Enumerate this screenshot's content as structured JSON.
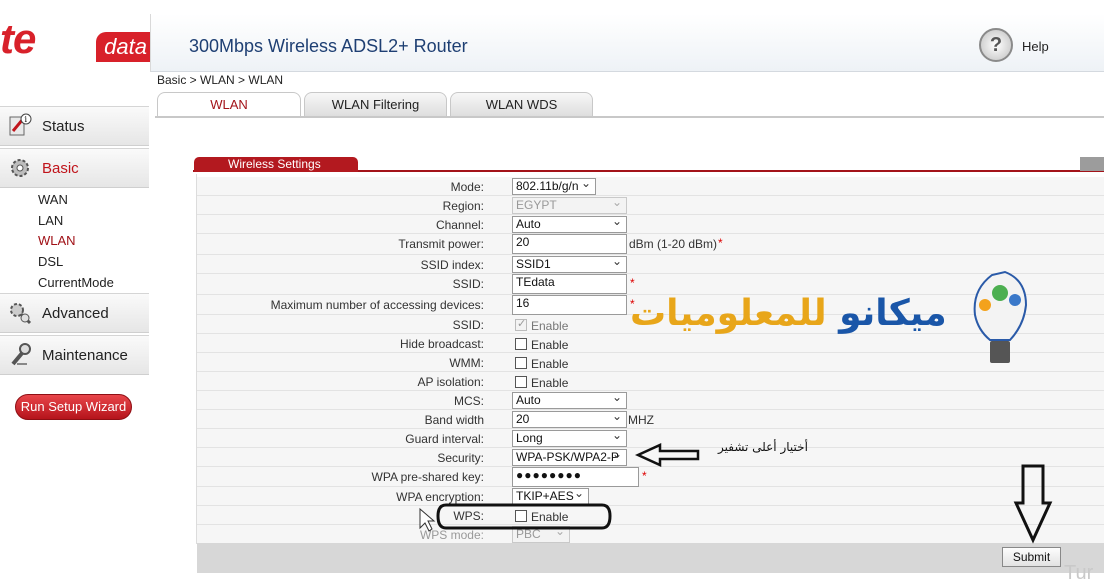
{
  "brand": {
    "logo_te": "te",
    "logo_data": "data"
  },
  "header": {
    "title": "300Mbps Wireless ADSL2+ Router",
    "help_label": "Help"
  },
  "breadcrumb": "Basic > WLAN > WLAN",
  "tabs": [
    {
      "label": "WLAN"
    },
    {
      "label": "WLAN Filtering"
    },
    {
      "label": "WLAN WDS"
    }
  ],
  "sidebar": {
    "status": "Status",
    "basic": "Basic",
    "basic_items": [
      "WAN",
      "LAN",
      "WLAN",
      "DSL",
      "CurrentMode"
    ],
    "advanced": "Advanced",
    "maintenance": "Maintenance",
    "wizard": "Run Setup Wizard"
  },
  "section_title": "Wireless Settings",
  "form": {
    "mode": {
      "label": "Mode:",
      "value": "802.11b/g/n"
    },
    "region": {
      "label": "Region:",
      "value": "EGYPT"
    },
    "channel": {
      "label": "Channel:",
      "value": "Auto"
    },
    "tx_power": {
      "label": "Transmit power:",
      "value": "20",
      "unit": "dBm (1-20 dBm)"
    },
    "ssid_index": {
      "label": "SSID index:",
      "value": "SSID1"
    },
    "ssid": {
      "label": "SSID:",
      "value": "TEdata"
    },
    "max_devices": {
      "label": "Maximum number of accessing devices:",
      "value": "16"
    },
    "ssid_enable": {
      "label": "SSID:",
      "enable": "Enable",
      "checked": true
    },
    "hide_broadcast": {
      "label": "Hide broadcast:",
      "enable": "Enable",
      "checked": false
    },
    "wmm": {
      "label": "WMM:",
      "enable": "Enable",
      "checked": false
    },
    "ap_isolation": {
      "label": "AP isolation:",
      "enable": "Enable",
      "checked": false
    },
    "mcs": {
      "label": "MCS:",
      "value": "Auto"
    },
    "bandwidth": {
      "label": "Band width",
      "value": "20",
      "unit": "MHZ"
    },
    "guard": {
      "label": "Guard interval:",
      "value": "Long"
    },
    "security": {
      "label": "Security:",
      "value": "WPA-PSK/WPA2-P"
    },
    "psk": {
      "label": "WPA pre-shared key:",
      "value": "●●●●●●●●"
    },
    "encryption": {
      "label": "WPA encryption:",
      "value": "TKIP+AES"
    },
    "wps": {
      "label": "WPS:",
      "enable": "Enable",
      "checked": false
    },
    "wps_mode": {
      "label": "WPS mode:",
      "value": "PBC"
    },
    "required_mark": "*"
  },
  "submit_label": "Submit",
  "annotation_text": "أختيار أعلى تشفير",
  "watermark": {
    "part1": "ميكانو",
    "part2": "للمعلوميات"
  },
  "corner_text": "Tur",
  "colors": {
    "brand_red": "#d8212a",
    "accent_red": "#a31319",
    "title_blue": "#1e3f73"
  }
}
